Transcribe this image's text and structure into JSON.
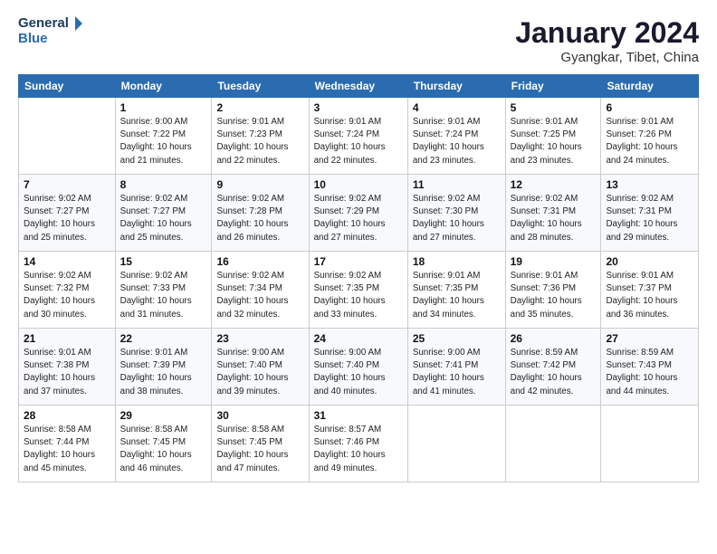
{
  "logo": {
    "line1": "General",
    "line2": "Blue"
  },
  "title": "January 2024",
  "subtitle": "Gyangkar, Tibet, China",
  "weekdays": [
    "Sunday",
    "Monday",
    "Tuesday",
    "Wednesday",
    "Thursday",
    "Friday",
    "Saturday"
  ],
  "weeks": [
    [
      {
        "num": "",
        "info": ""
      },
      {
        "num": "1",
        "info": "Sunrise: 9:00 AM\nSunset: 7:22 PM\nDaylight: 10 hours\nand 21 minutes."
      },
      {
        "num": "2",
        "info": "Sunrise: 9:01 AM\nSunset: 7:23 PM\nDaylight: 10 hours\nand 22 minutes."
      },
      {
        "num": "3",
        "info": "Sunrise: 9:01 AM\nSunset: 7:24 PM\nDaylight: 10 hours\nand 22 minutes."
      },
      {
        "num": "4",
        "info": "Sunrise: 9:01 AM\nSunset: 7:24 PM\nDaylight: 10 hours\nand 23 minutes."
      },
      {
        "num": "5",
        "info": "Sunrise: 9:01 AM\nSunset: 7:25 PM\nDaylight: 10 hours\nand 23 minutes."
      },
      {
        "num": "6",
        "info": "Sunrise: 9:01 AM\nSunset: 7:26 PM\nDaylight: 10 hours\nand 24 minutes."
      }
    ],
    [
      {
        "num": "7",
        "info": "Sunrise: 9:02 AM\nSunset: 7:27 PM\nDaylight: 10 hours\nand 25 minutes."
      },
      {
        "num": "8",
        "info": "Sunrise: 9:02 AM\nSunset: 7:27 PM\nDaylight: 10 hours\nand 25 minutes."
      },
      {
        "num": "9",
        "info": "Sunrise: 9:02 AM\nSunset: 7:28 PM\nDaylight: 10 hours\nand 26 minutes."
      },
      {
        "num": "10",
        "info": "Sunrise: 9:02 AM\nSunset: 7:29 PM\nDaylight: 10 hours\nand 27 minutes."
      },
      {
        "num": "11",
        "info": "Sunrise: 9:02 AM\nSunset: 7:30 PM\nDaylight: 10 hours\nand 27 minutes."
      },
      {
        "num": "12",
        "info": "Sunrise: 9:02 AM\nSunset: 7:31 PM\nDaylight: 10 hours\nand 28 minutes."
      },
      {
        "num": "13",
        "info": "Sunrise: 9:02 AM\nSunset: 7:31 PM\nDaylight: 10 hours\nand 29 minutes."
      }
    ],
    [
      {
        "num": "14",
        "info": "Sunrise: 9:02 AM\nSunset: 7:32 PM\nDaylight: 10 hours\nand 30 minutes."
      },
      {
        "num": "15",
        "info": "Sunrise: 9:02 AM\nSunset: 7:33 PM\nDaylight: 10 hours\nand 31 minutes."
      },
      {
        "num": "16",
        "info": "Sunrise: 9:02 AM\nSunset: 7:34 PM\nDaylight: 10 hours\nand 32 minutes."
      },
      {
        "num": "17",
        "info": "Sunrise: 9:02 AM\nSunset: 7:35 PM\nDaylight: 10 hours\nand 33 minutes."
      },
      {
        "num": "18",
        "info": "Sunrise: 9:01 AM\nSunset: 7:35 PM\nDaylight: 10 hours\nand 34 minutes."
      },
      {
        "num": "19",
        "info": "Sunrise: 9:01 AM\nSunset: 7:36 PM\nDaylight: 10 hours\nand 35 minutes."
      },
      {
        "num": "20",
        "info": "Sunrise: 9:01 AM\nSunset: 7:37 PM\nDaylight: 10 hours\nand 36 minutes."
      }
    ],
    [
      {
        "num": "21",
        "info": "Sunrise: 9:01 AM\nSunset: 7:38 PM\nDaylight: 10 hours\nand 37 minutes."
      },
      {
        "num": "22",
        "info": "Sunrise: 9:01 AM\nSunset: 7:39 PM\nDaylight: 10 hours\nand 38 minutes."
      },
      {
        "num": "23",
        "info": "Sunrise: 9:00 AM\nSunset: 7:40 PM\nDaylight: 10 hours\nand 39 minutes."
      },
      {
        "num": "24",
        "info": "Sunrise: 9:00 AM\nSunset: 7:40 PM\nDaylight: 10 hours\nand 40 minutes."
      },
      {
        "num": "25",
        "info": "Sunrise: 9:00 AM\nSunset: 7:41 PM\nDaylight: 10 hours\nand 41 minutes."
      },
      {
        "num": "26",
        "info": "Sunrise: 8:59 AM\nSunset: 7:42 PM\nDaylight: 10 hours\nand 42 minutes."
      },
      {
        "num": "27",
        "info": "Sunrise: 8:59 AM\nSunset: 7:43 PM\nDaylight: 10 hours\nand 44 minutes."
      }
    ],
    [
      {
        "num": "28",
        "info": "Sunrise: 8:58 AM\nSunset: 7:44 PM\nDaylight: 10 hours\nand 45 minutes."
      },
      {
        "num": "29",
        "info": "Sunrise: 8:58 AM\nSunset: 7:45 PM\nDaylight: 10 hours\nand 46 minutes."
      },
      {
        "num": "30",
        "info": "Sunrise: 8:58 AM\nSunset: 7:45 PM\nDaylight: 10 hours\nand 47 minutes."
      },
      {
        "num": "31",
        "info": "Sunrise: 8:57 AM\nSunset: 7:46 PM\nDaylight: 10 hours\nand 49 minutes."
      },
      {
        "num": "",
        "info": ""
      },
      {
        "num": "",
        "info": ""
      },
      {
        "num": "",
        "info": ""
      }
    ]
  ]
}
